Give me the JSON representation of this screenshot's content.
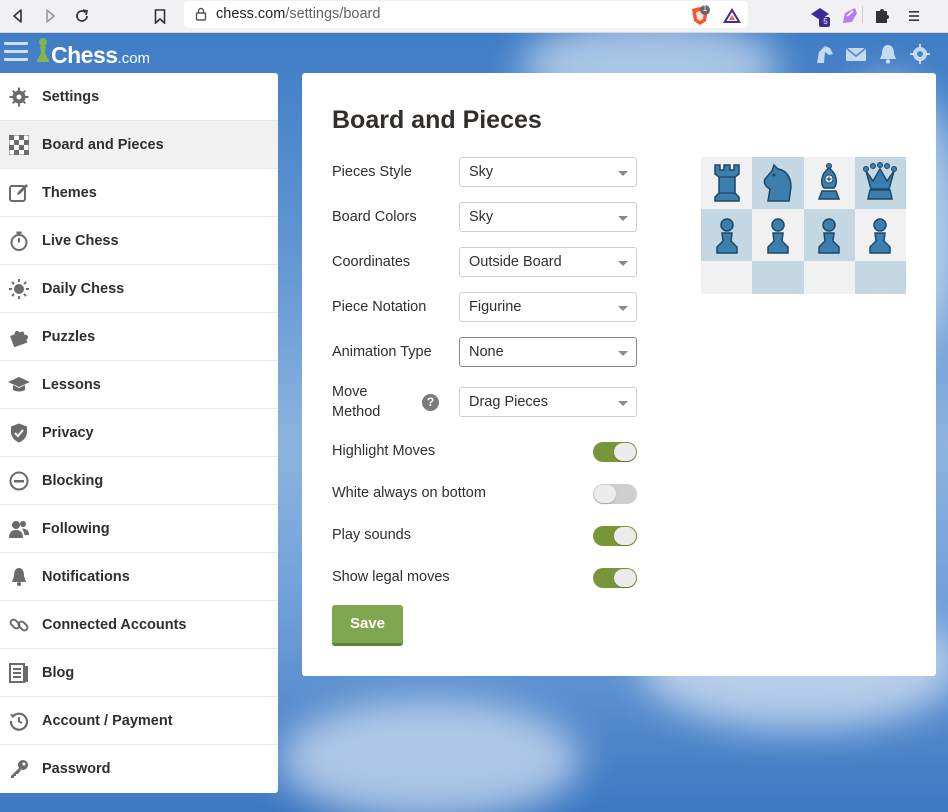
{
  "browser": {
    "url_host": "chess.com",
    "url_path": "/settings/board",
    "brave_badge": "1",
    "ext_badge": "5"
  },
  "sidebar": {
    "items": [
      {
        "label": "Settings",
        "icon": "gear-icon",
        "active": false
      },
      {
        "label": "Board and Pieces",
        "icon": "board-icon",
        "active": true
      },
      {
        "label": "Themes",
        "icon": "edit-icon",
        "active": false
      },
      {
        "label": "Live Chess",
        "icon": "stopwatch-icon",
        "active": false
      },
      {
        "label": "Daily Chess",
        "icon": "sun-icon",
        "active": false
      },
      {
        "label": "Puzzles",
        "icon": "puzzle-icon",
        "active": false
      },
      {
        "label": "Lessons",
        "icon": "graduation-cap-icon",
        "active": false
      },
      {
        "label": "Privacy",
        "icon": "shield-icon",
        "active": false
      },
      {
        "label": "Blocking",
        "icon": "block-icon",
        "active": false
      },
      {
        "label": "Following",
        "icon": "people-icon",
        "active": false
      },
      {
        "label": "Notifications",
        "icon": "bell-icon",
        "active": false
      },
      {
        "label": "Connected Accounts",
        "icon": "link-icon",
        "active": false
      },
      {
        "label": "Blog",
        "icon": "blog-icon",
        "active": false
      },
      {
        "label": "Account / Payment",
        "icon": "history-icon",
        "active": false
      },
      {
        "label": "Password",
        "icon": "key-icon",
        "active": false
      }
    ]
  },
  "main": {
    "title": "Board and Pieces",
    "selects": [
      {
        "label": "Pieces Style",
        "value": "Sky"
      },
      {
        "label": "Board Colors",
        "value": "Sky"
      },
      {
        "label": "Coordinates",
        "value": "Outside Board"
      },
      {
        "label": "Piece Notation",
        "value": "Figurine"
      },
      {
        "label": "Animation Type",
        "value": "None"
      },
      {
        "label_line1": "Move",
        "label_line2": "Method",
        "value": "Drag Pieces",
        "help": "?"
      }
    ],
    "toggles": [
      {
        "label": "Highlight Moves",
        "on": true
      },
      {
        "label": "White always on bottom",
        "on": false
      },
      {
        "label": "Play sounds",
        "on": true
      },
      {
        "label": "Show legal moves",
        "on": true
      }
    ],
    "save_label": "Save"
  },
  "colors": {
    "accent_green": "#77963a",
    "save_green": "#7fa650",
    "piece_blue": "#3c7fae",
    "board_light": "#f0f1f0",
    "board_dark": "#c4d8e4"
  }
}
